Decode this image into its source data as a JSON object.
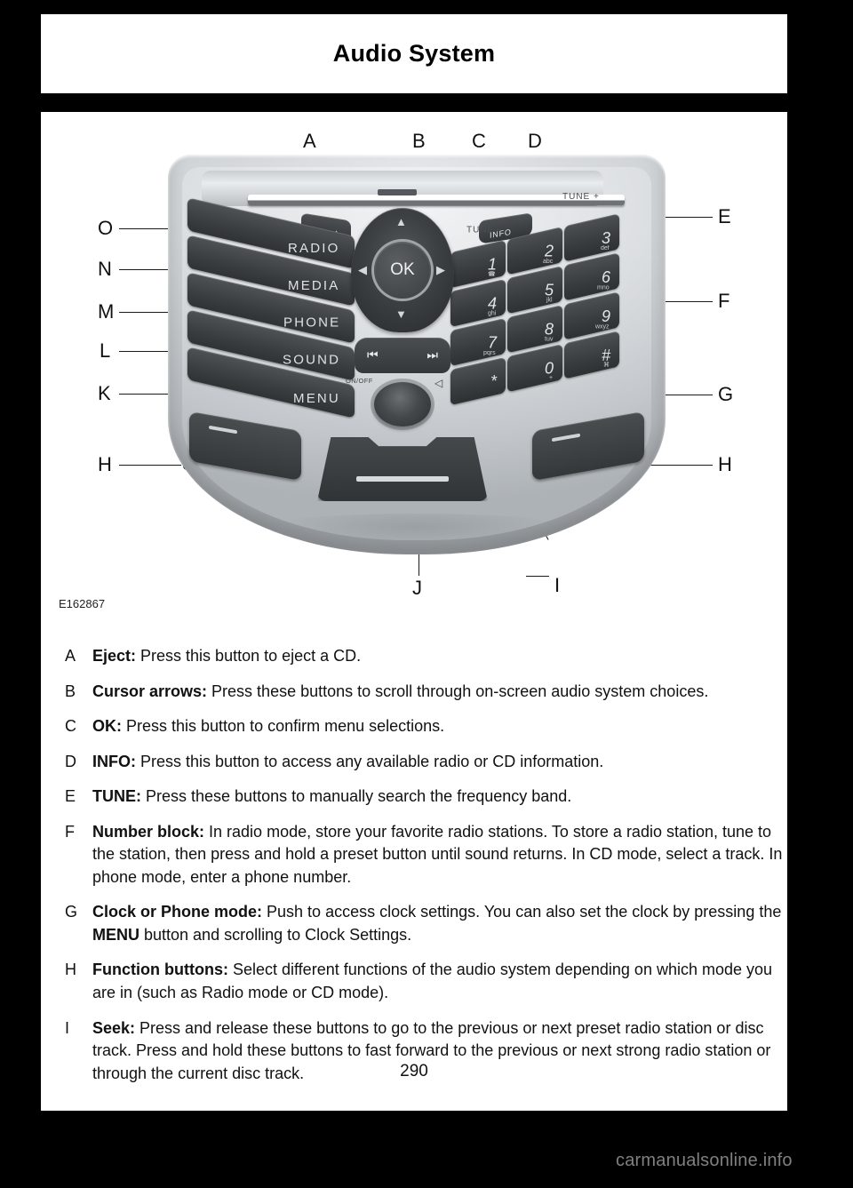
{
  "header": {
    "title": "Audio System"
  },
  "figure": {
    "code": "E162867",
    "callouts_top": [
      "A",
      "B",
      "C",
      "D"
    ],
    "callouts_left": [
      "O",
      "N",
      "M",
      "L",
      "K",
      "H"
    ],
    "callouts_right": [
      "E",
      "F",
      "G",
      "H"
    ],
    "callouts_bottom": [
      "J",
      "I"
    ],
    "unit_labels": {
      "radio": "RADIO",
      "media": "MEDIA",
      "phone": "PHONE",
      "sound": "SOUND",
      "menu": "MENU",
      "info": "INFO",
      "ok": "OK",
      "onoff": "ON/OFF",
      "tune_minus": "TUNE–",
      "tune_plus": "TUNE +",
      "seek_prev": "⏮",
      "seek_next": "⏭",
      "arrow_up": "▲",
      "arrow_down": "▼",
      "arrow_left": "◀",
      "arrow_right": "▶",
      "eject": "▲",
      "volume": "◁"
    },
    "keypad": [
      {
        "digit": "1",
        "sub": "☎"
      },
      {
        "digit": "2",
        "sub": "abc"
      },
      {
        "digit": "3",
        "sub": "def"
      },
      {
        "digit": "4",
        "sub": "ghi"
      },
      {
        "digit": "5",
        "sub": "jkl"
      },
      {
        "digit": "6",
        "sub": "mno"
      },
      {
        "digit": "7",
        "sub": "pqrs"
      },
      {
        "digit": "8",
        "sub": "tuv"
      },
      {
        "digit": "9",
        "sub": "wxyz"
      },
      {
        "digit": "*",
        "sub": ""
      },
      {
        "digit": "0",
        "sub": "+"
      },
      {
        "digit": "#",
        "sub": "⌘"
      }
    ]
  },
  "descriptions": [
    {
      "letter": "A",
      "term": "Eject:",
      "text": " Press this button to eject a CD."
    },
    {
      "letter": "B",
      "term": "Cursor arrows:",
      "text": " Press these buttons to scroll through on-screen audio system choices."
    },
    {
      "letter": "C",
      "term": "OK:",
      "text": " Press this button to confirm menu selections."
    },
    {
      "letter": "D",
      "term": "INFO:",
      "text": " Press this button to access any available radio or CD information."
    },
    {
      "letter": "E",
      "term": "TUNE:",
      "text": " Press these buttons to manually search the frequency band."
    },
    {
      "letter": "F",
      "term": "Number block:",
      "text": " In radio mode, store your favorite radio stations. To store a radio station, tune to the station, then press and hold a preset button until sound returns. In CD mode, select a track. In phone mode, enter a phone number."
    },
    {
      "letter": "G",
      "term": "Clock or Phone mode:",
      "text": " Push to access clock settings. You can also set the clock by pressing the MENU button and scrolling to Clock Settings.",
      "text_before_bold": " Push to access clock settings. You can also set the clock by pressing the ",
      "inline_bold": "MENU",
      "text_after_bold": " button and scrolling to Clock Settings."
    },
    {
      "letter": "H",
      "term": "Function buttons:",
      "text": " Select different functions of the audio system depending on which mode you are in (such as Radio mode or CD mode)."
    },
    {
      "letter": "I",
      "term": "Seek:",
      "text": " Press and release these buttons to go to the previous or next preset radio station or disc track. Press and hold these buttons to fast forward to the previous or next strong radio station or through the current disc track."
    }
  ],
  "footer": {
    "page_number": "290",
    "watermark": "carmanualsonline.info"
  }
}
